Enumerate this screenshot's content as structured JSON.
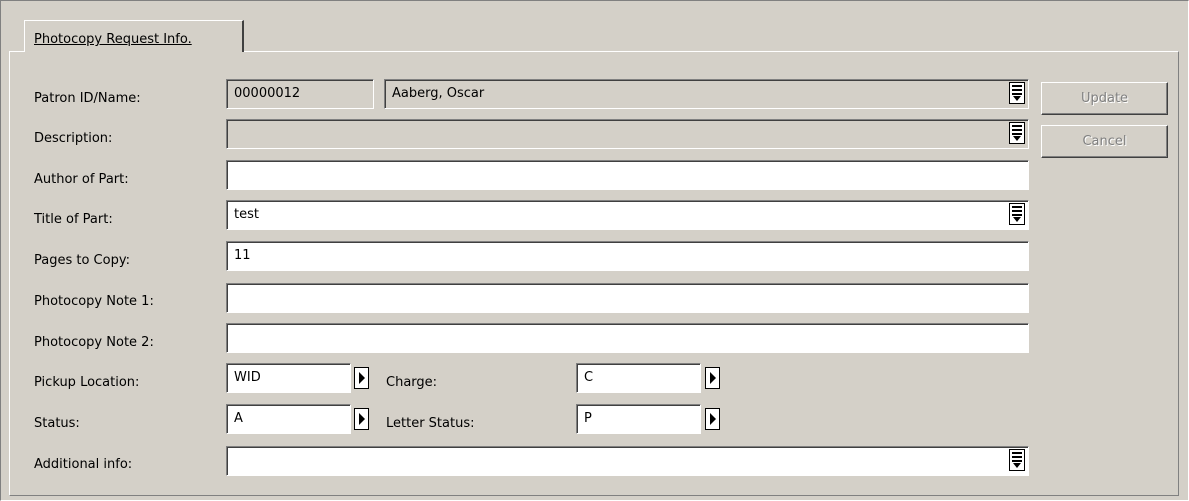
{
  "tab": {
    "label": "Photocopy Request Info."
  },
  "labels": {
    "patron": "Patron ID/Name:",
    "description": "Description:",
    "author": "Author of Part:",
    "title": "Title of Part:",
    "pages": "Pages to Copy:",
    "note1": "Photocopy Note 1:",
    "note2": "Photocopy Note 2:",
    "pickup": "Pickup Location:",
    "charge": "Charge:",
    "status": "Status:",
    "letter_status": "Letter Status:",
    "additional": "Additional info:"
  },
  "values": {
    "patron_id": "00000012",
    "patron_name": "Aaberg, Oscar",
    "description": "",
    "author": "",
    "title": "test",
    "pages": "11",
    "note1": "",
    "note2": "",
    "pickup": "WID",
    "charge": "C",
    "status": "A",
    "letter_status": "P",
    "additional": ""
  },
  "buttons": {
    "update": "Update",
    "cancel": "Cancel"
  },
  "icons": {
    "lookup": "lookup-list-icon",
    "arrow": "right-arrow-icon"
  }
}
